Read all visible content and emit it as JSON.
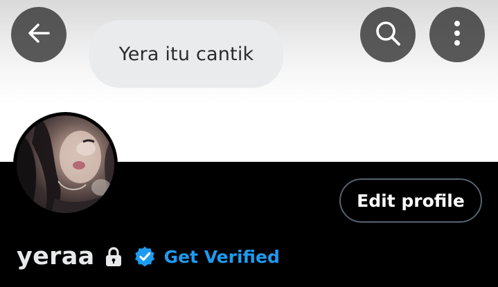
{
  "banner": {
    "bubble_text": "Yera itu cantik"
  },
  "top_bar": {
    "back_icon": "arrow-left-icon",
    "search_icon": "search-icon",
    "more_icon": "more-vertical-icon"
  },
  "profile": {
    "display_name": "yeraa",
    "edit_profile_label": "Edit profile",
    "get_verified_label": "Get Verified",
    "lock_icon": "lock-icon",
    "verified_icon": "verified-badge-icon"
  },
  "colors": {
    "background": "#000000",
    "accent_blue": "#1d9bf0",
    "button_border": "#566370",
    "bubble": "#e9ebec"
  }
}
